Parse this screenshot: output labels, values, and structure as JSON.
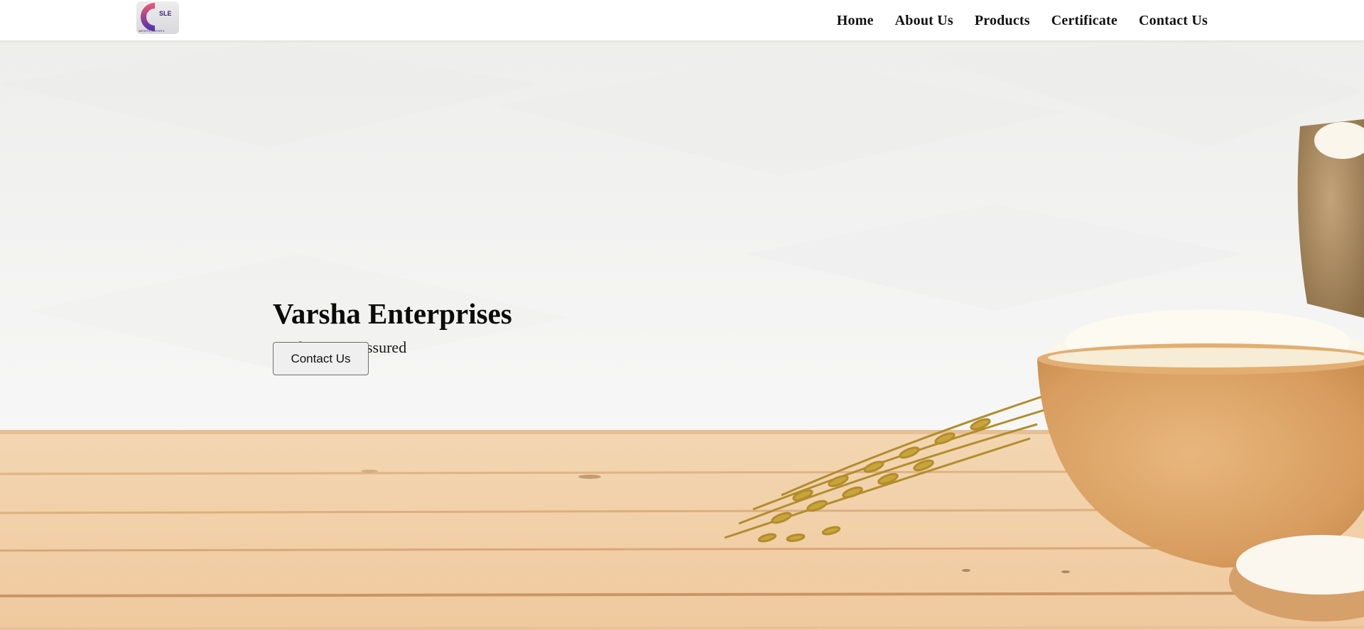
{
  "header": {
    "logo": {
      "letters": "SLE",
      "tagline": "IMPORTS | EXPORTS",
      "colors": {
        "ring_top": "#e2567a",
        "ring_bottom": "#5b34a8",
        "text": "#3c1f7a"
      }
    },
    "nav": [
      {
        "label": "Home"
      },
      {
        "label": "About Us"
      },
      {
        "label": "Products"
      },
      {
        "label": "Certificate"
      },
      {
        "label": "Contact Us"
      }
    ]
  },
  "hero": {
    "title": "Varsha Enterprises",
    "subtitle": "Quality Rice Assured",
    "cta_label": "Contact Us",
    "background": {
      "description_icons": [
        "wooden-table",
        "rice-bowl",
        "rice-sack",
        "rice-stalks",
        "rice-spoon"
      ],
      "colors": {
        "wall": "#f1f1f0",
        "wood": "#f1cfa6",
        "wood_dark": "#d7a876",
        "bowl": "#dba66a",
        "grain": "#fbf6ea",
        "stalks": "#c9a43a",
        "sack": "#b59870"
      }
    }
  }
}
